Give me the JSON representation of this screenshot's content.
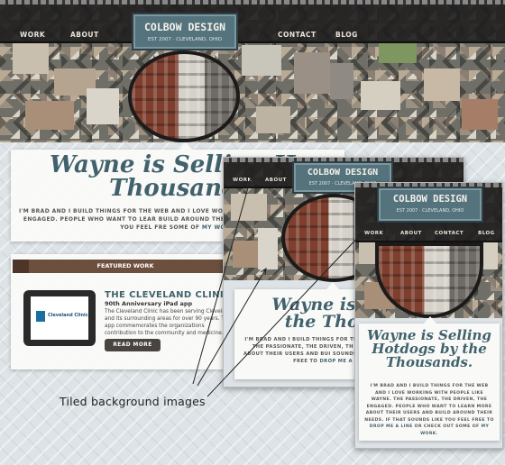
{
  "brand": {
    "name": "COLBOW DESIGN",
    "tagline": "EST 2007  ·  CLEVELAND, OHIO"
  },
  "nav": {
    "work": "WORK",
    "about": "ABOUT",
    "contact": "CONTACT",
    "blog": "BLOG"
  },
  "hero": {
    "headline_main_line1": "Wayne is Selling Ho",
    "headline_main_line2": "Thousands",
    "headline_mid_line1": "Wayne is Sellin",
    "headline_mid_line2": "the Thousan",
    "headline_small_line1": "Wayne is Selling",
    "headline_small_line2": "Hotdogs by the",
    "headline_small_line3": "Thousands."
  },
  "intro": {
    "main": "I'm Brad and I build things for the web and I love work PASSIONATE, THE DRIVEN, THE ENGAGED. PEOPLE WHO WANT TO LEAR BUILD AROUND THEIR NEEDS. IF THAT SOUNDS LIKE YOU FEEL FRE SOME OF",
    "main_link": "MY WORK.",
    "mid": "I'M BRAD AND I BUILD THINGS FOR THE LIKE WAYNE. THE PASSIONATE, THE DRIVEN, TH LEARN MORE ABOUT THEIR USERS AND BUI SOUNDS LIKE YOU FEEL FREE TO",
    "mid_link": "DROP ME A",
    "small": "I'M BRAD AND I BUILD THINGS FOR THE WEB AND I LOVE WORKING WITH PEOPLE LIKE WAYNE. THE PASSIONATE, THE DRIVEN, THE ENGAGED. PEOPLE WHO WANT TO LEARN MORE ABOUT THEIR USERS AND BUILD AROUND THEIR NEEDS. IF THAT SOUNDS LIKE YOU FEEL FREE TO",
    "small_link1": "DROP ME A LINE",
    "small_mid": "OR CHECK OUT SOME OF",
    "small_link2": "MY WORK."
  },
  "featured": {
    "ribbon": "FEATURED WORK",
    "project_title": "THE CLEVELAND CLINIC",
    "project_sub": "90th Anniversary iPad app",
    "project_desc": "The Cleveland Clinic has been serving Cleveland and its surrounding areas for over 90 years. This app commemorates the organizations contribution to the community and medicine.",
    "screen_logo": "Cleveland Clinic",
    "read_more": "READ MORE"
  },
  "annotation": {
    "text": "Tiled background images"
  },
  "colors": {
    "accent": "#41626c",
    "badge": "#55737c",
    "nav_bg": "#21201f",
    "ribbon": "#6d4f3e"
  }
}
